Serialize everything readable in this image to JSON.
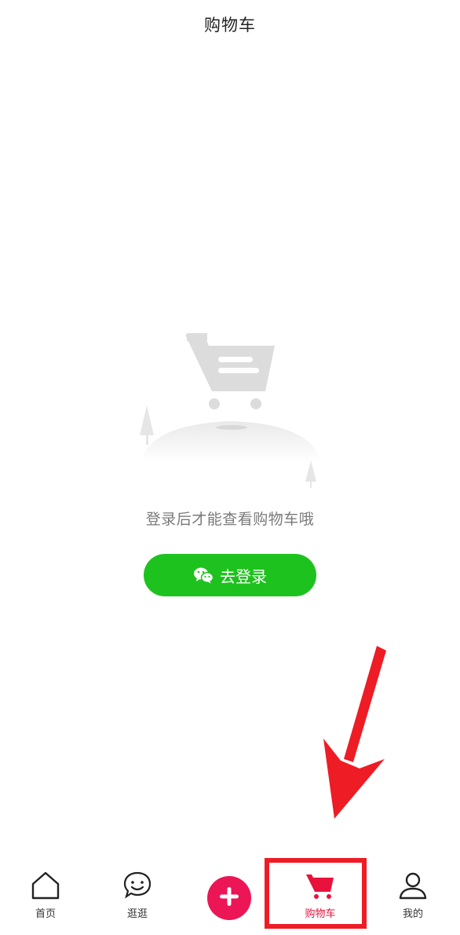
{
  "header": {
    "title": "购物车"
  },
  "empty": {
    "message": "登录后才能查看购物车哦",
    "illustration_icon": "empty-cart-illustration"
  },
  "login": {
    "label": "去登录",
    "icon": "wechat-icon",
    "color": "#1ec21e"
  },
  "tabbar": {
    "items": [
      {
        "label": "首页",
        "icon": "home-icon"
      },
      {
        "label": "逛逛",
        "icon": "smile-chat-icon"
      },
      {
        "label": "",
        "icon": "plus-icon"
      },
      {
        "label": "购物车",
        "icon": "cart-icon",
        "active": true
      },
      {
        "label": "我的",
        "icon": "user-icon"
      }
    ],
    "active_color": "#e8123c",
    "publish_color": "#ec1656"
  },
  "annotation": {
    "color": "#ee1c24"
  }
}
